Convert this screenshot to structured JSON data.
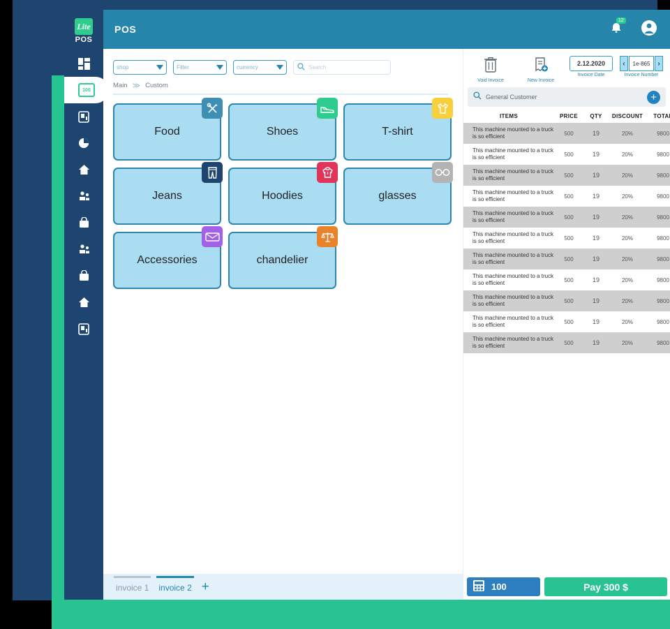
{
  "window": {
    "title": "POS"
  },
  "brand": {
    "mark": "Lite",
    "word": "POS"
  },
  "sidebar": {
    "items": [
      {
        "name": "dashboard",
        "icon": "grid-icon"
      },
      {
        "name": "pos",
        "icon": "calculator-icon",
        "label": "100",
        "active": true
      },
      {
        "name": "invoices",
        "icon": "document-icon"
      },
      {
        "name": "reports",
        "icon": "pie-chart-icon"
      },
      {
        "name": "home",
        "icon": "home-icon"
      },
      {
        "name": "customers",
        "icon": "people-icon"
      },
      {
        "name": "products",
        "icon": "bag-icon"
      },
      {
        "name": "suppliers",
        "icon": "people-icon"
      },
      {
        "name": "stock",
        "icon": "bag-icon"
      },
      {
        "name": "branches",
        "icon": "home-icon"
      },
      {
        "name": "settings",
        "icon": "document-icon"
      }
    ]
  },
  "topbar": {
    "title": "POS",
    "bell_icon": "bell-icon",
    "notification_count": "12",
    "avatar_icon": "user-avatar-icon"
  },
  "filters": {
    "shop": {
      "value": "shop"
    },
    "filter": {
      "value": "Filter"
    },
    "currency": {
      "value": "currency"
    },
    "search": {
      "placeholder": "Search",
      "value": ""
    }
  },
  "breadcrumb": {
    "root": "Main",
    "separator": "≫",
    "current": "Custom"
  },
  "categories": [
    {
      "label": "Food",
      "icon": "cutlery-icon",
      "color": "#3f8fb5"
    },
    {
      "label": "Shoes",
      "icon": "sneaker-icon",
      "color": "#2ecc8f"
    },
    {
      "label": "T-shirt",
      "icon": "tshirt-icon",
      "color": "#f8cf3c"
    },
    {
      "label": "Jeans",
      "icon": "jeans-icon",
      "color": "#1d4570"
    },
    {
      "label": "Hoodies",
      "icon": "hoodie-icon",
      "color": "#e0345a"
    },
    {
      "label": "glasses",
      "icon": "glasses-icon",
      "color": "#b3b3b3"
    },
    {
      "label": "Accessories",
      "icon": "wallet-icon",
      "color": "#a261e8"
    },
    {
      "label": "chandelier",
      "icon": "scales-icon",
      "color": "#e8832c"
    }
  ],
  "invoice_tabs": {
    "tabs": [
      {
        "label": "invoice 1",
        "active": false
      },
      {
        "label": "invoice 2",
        "active": true
      }
    ],
    "add_label": "+"
  },
  "invoice_actions": {
    "void": {
      "label": "Void Invoice",
      "icon": "trash-icon"
    },
    "new": {
      "label": "New Invoice",
      "icon": "new-receipt-icon"
    },
    "date": {
      "label": "Invoice Date",
      "value": "2.12.2020"
    },
    "number": {
      "label": "Invoice Number",
      "value": "1e-865",
      "prev": "‹",
      "next": "›"
    }
  },
  "customer": {
    "name": "General Customer",
    "search_icon": "search-icon",
    "add_icon": "plus-icon"
  },
  "items_table": {
    "columns": [
      "ITEMS",
      "PRICE",
      "QTY",
      "DISCOUNT",
      "TOTAL"
    ],
    "rows": [
      {
        "item": "This machine mounted to a truck is so efficient",
        "price": "500",
        "qty": "19",
        "discount": "20%",
        "total": "9800"
      },
      {
        "item": "This machine mounted to a truck is so efficient",
        "price": "500",
        "qty": "19",
        "discount": "20%",
        "total": "9800"
      },
      {
        "item": "This machine mounted to a truck is so efficient",
        "price": "500",
        "qty": "19",
        "discount": "20%",
        "total": "9800"
      },
      {
        "item": "This machine mounted to a truck is so efficient",
        "price": "500",
        "qty": "19",
        "discount": "20%",
        "total": "9800"
      },
      {
        "item": "This machine mounted to a truck is so efficient",
        "price": "500",
        "qty": "19",
        "discount": "20%",
        "total": "9800"
      },
      {
        "item": "This machine mounted to a truck is so efficient",
        "price": "500",
        "qty": "19",
        "discount": "20%",
        "total": "9800"
      },
      {
        "item": "This machine mounted to a truck is so efficient",
        "price": "500",
        "qty": "19",
        "discount": "20%",
        "total": "9800"
      },
      {
        "item": "This machine mounted to a truck is so efficient",
        "price": "500",
        "qty": "19",
        "discount": "20%",
        "total": "9800"
      },
      {
        "item": "This machine mounted to a truck is so efficient",
        "price": "500",
        "qty": "19",
        "discount": "20%",
        "total": "9800"
      },
      {
        "item": "This machine mounted to a truck is so efficient",
        "price": "500",
        "qty": "19",
        "discount": "20%",
        "total": "9800"
      },
      {
        "item": "This machine mounted to a truck is so efficient",
        "price": "500",
        "qty": "19",
        "discount": "20%",
        "total": "9800"
      }
    ]
  },
  "paybar": {
    "calculator": {
      "value": "100",
      "icon": "calculator-icon"
    },
    "pay": {
      "label": "Pay 300 $"
    }
  },
  "colors": {
    "navy": "#1d4570",
    "green": "#27c491",
    "header_blue": "#2585ab",
    "tile_fill": "#aadcf2",
    "tile_border": "#2f86ad"
  }
}
